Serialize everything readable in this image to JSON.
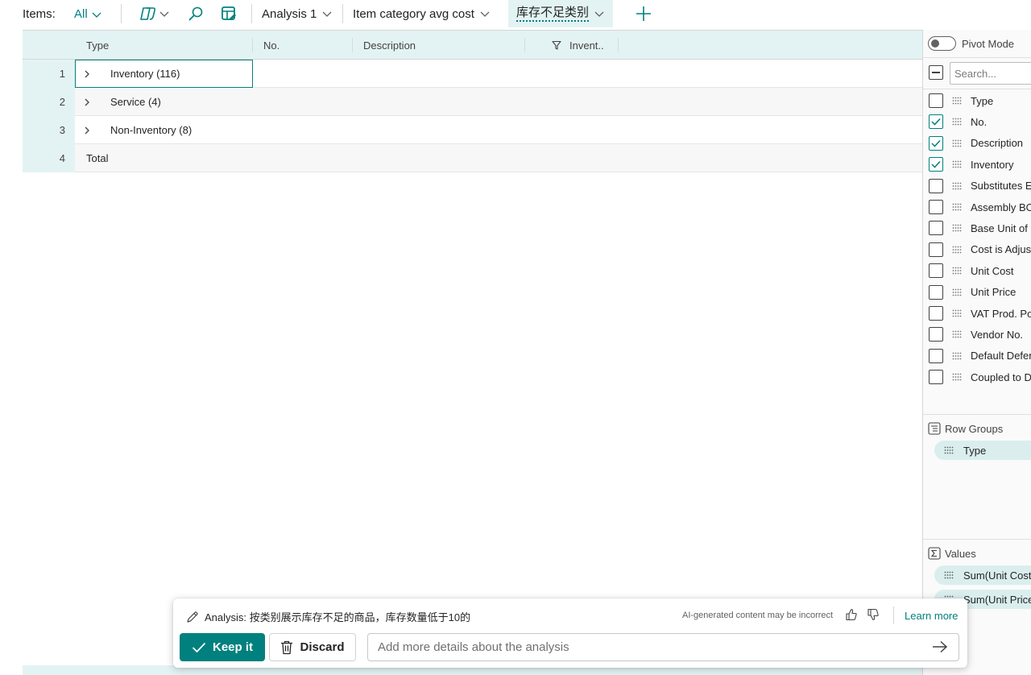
{
  "toolbar": {
    "items_label": "Items:",
    "filter_value": "All",
    "tabs": [
      {
        "label": "Analysis 1"
      },
      {
        "label": "Item category avg cost"
      },
      {
        "label": "库存不足类别"
      }
    ]
  },
  "grid": {
    "columns": [
      "Type",
      "No.",
      "Description",
      "Invent.."
    ],
    "rows": [
      {
        "num": "1",
        "label": "Inventory (116)"
      },
      {
        "num": "2",
        "label": "Service (4)"
      },
      {
        "num": "3",
        "label": "Non-Inventory (8)"
      },
      {
        "num": "4",
        "label": "Total"
      }
    ]
  },
  "panel": {
    "pivot_label": "Pivot Mode",
    "search_placeholder": "Search...",
    "columns": [
      {
        "label": "Type",
        "checked": false
      },
      {
        "label": "No.",
        "checked": true
      },
      {
        "label": "Description",
        "checked": true
      },
      {
        "label": "Inventory",
        "checked": true
      },
      {
        "label": "Substitutes E",
        "checked": false
      },
      {
        "label": "Assembly BO",
        "checked": false
      },
      {
        "label": "Base Unit of",
        "checked": false
      },
      {
        "label": "Cost is Adjus",
        "checked": false
      },
      {
        "label": "Unit Cost",
        "checked": false
      },
      {
        "label": "Unit Price",
        "checked": false
      },
      {
        "label": "VAT Prod. Po",
        "checked": false
      },
      {
        "label": "Vendor No.",
        "checked": false
      },
      {
        "label": "Default Defer",
        "checked": false
      },
      {
        "label": "Coupled to D",
        "checked": false
      }
    ],
    "row_groups_title": "Row Groups",
    "row_groups": [
      "Type"
    ],
    "values_title": "Values",
    "values": [
      "Sum(Unit Cost",
      "Sum(Unit Price"
    ]
  },
  "prompt": {
    "analysis_text": "Analysis: 按类别展示库存不足的商品，库存数量低于10的",
    "disclaimer": "AI-generated content may be incorrect",
    "learn_more": "Learn more",
    "keep_label": "Keep it",
    "discard_label": "Discard",
    "input_placeholder": "Add more details about the analysis"
  },
  "colors": {
    "accent": "#00807e",
    "header_bg": "#e3f3f3"
  }
}
